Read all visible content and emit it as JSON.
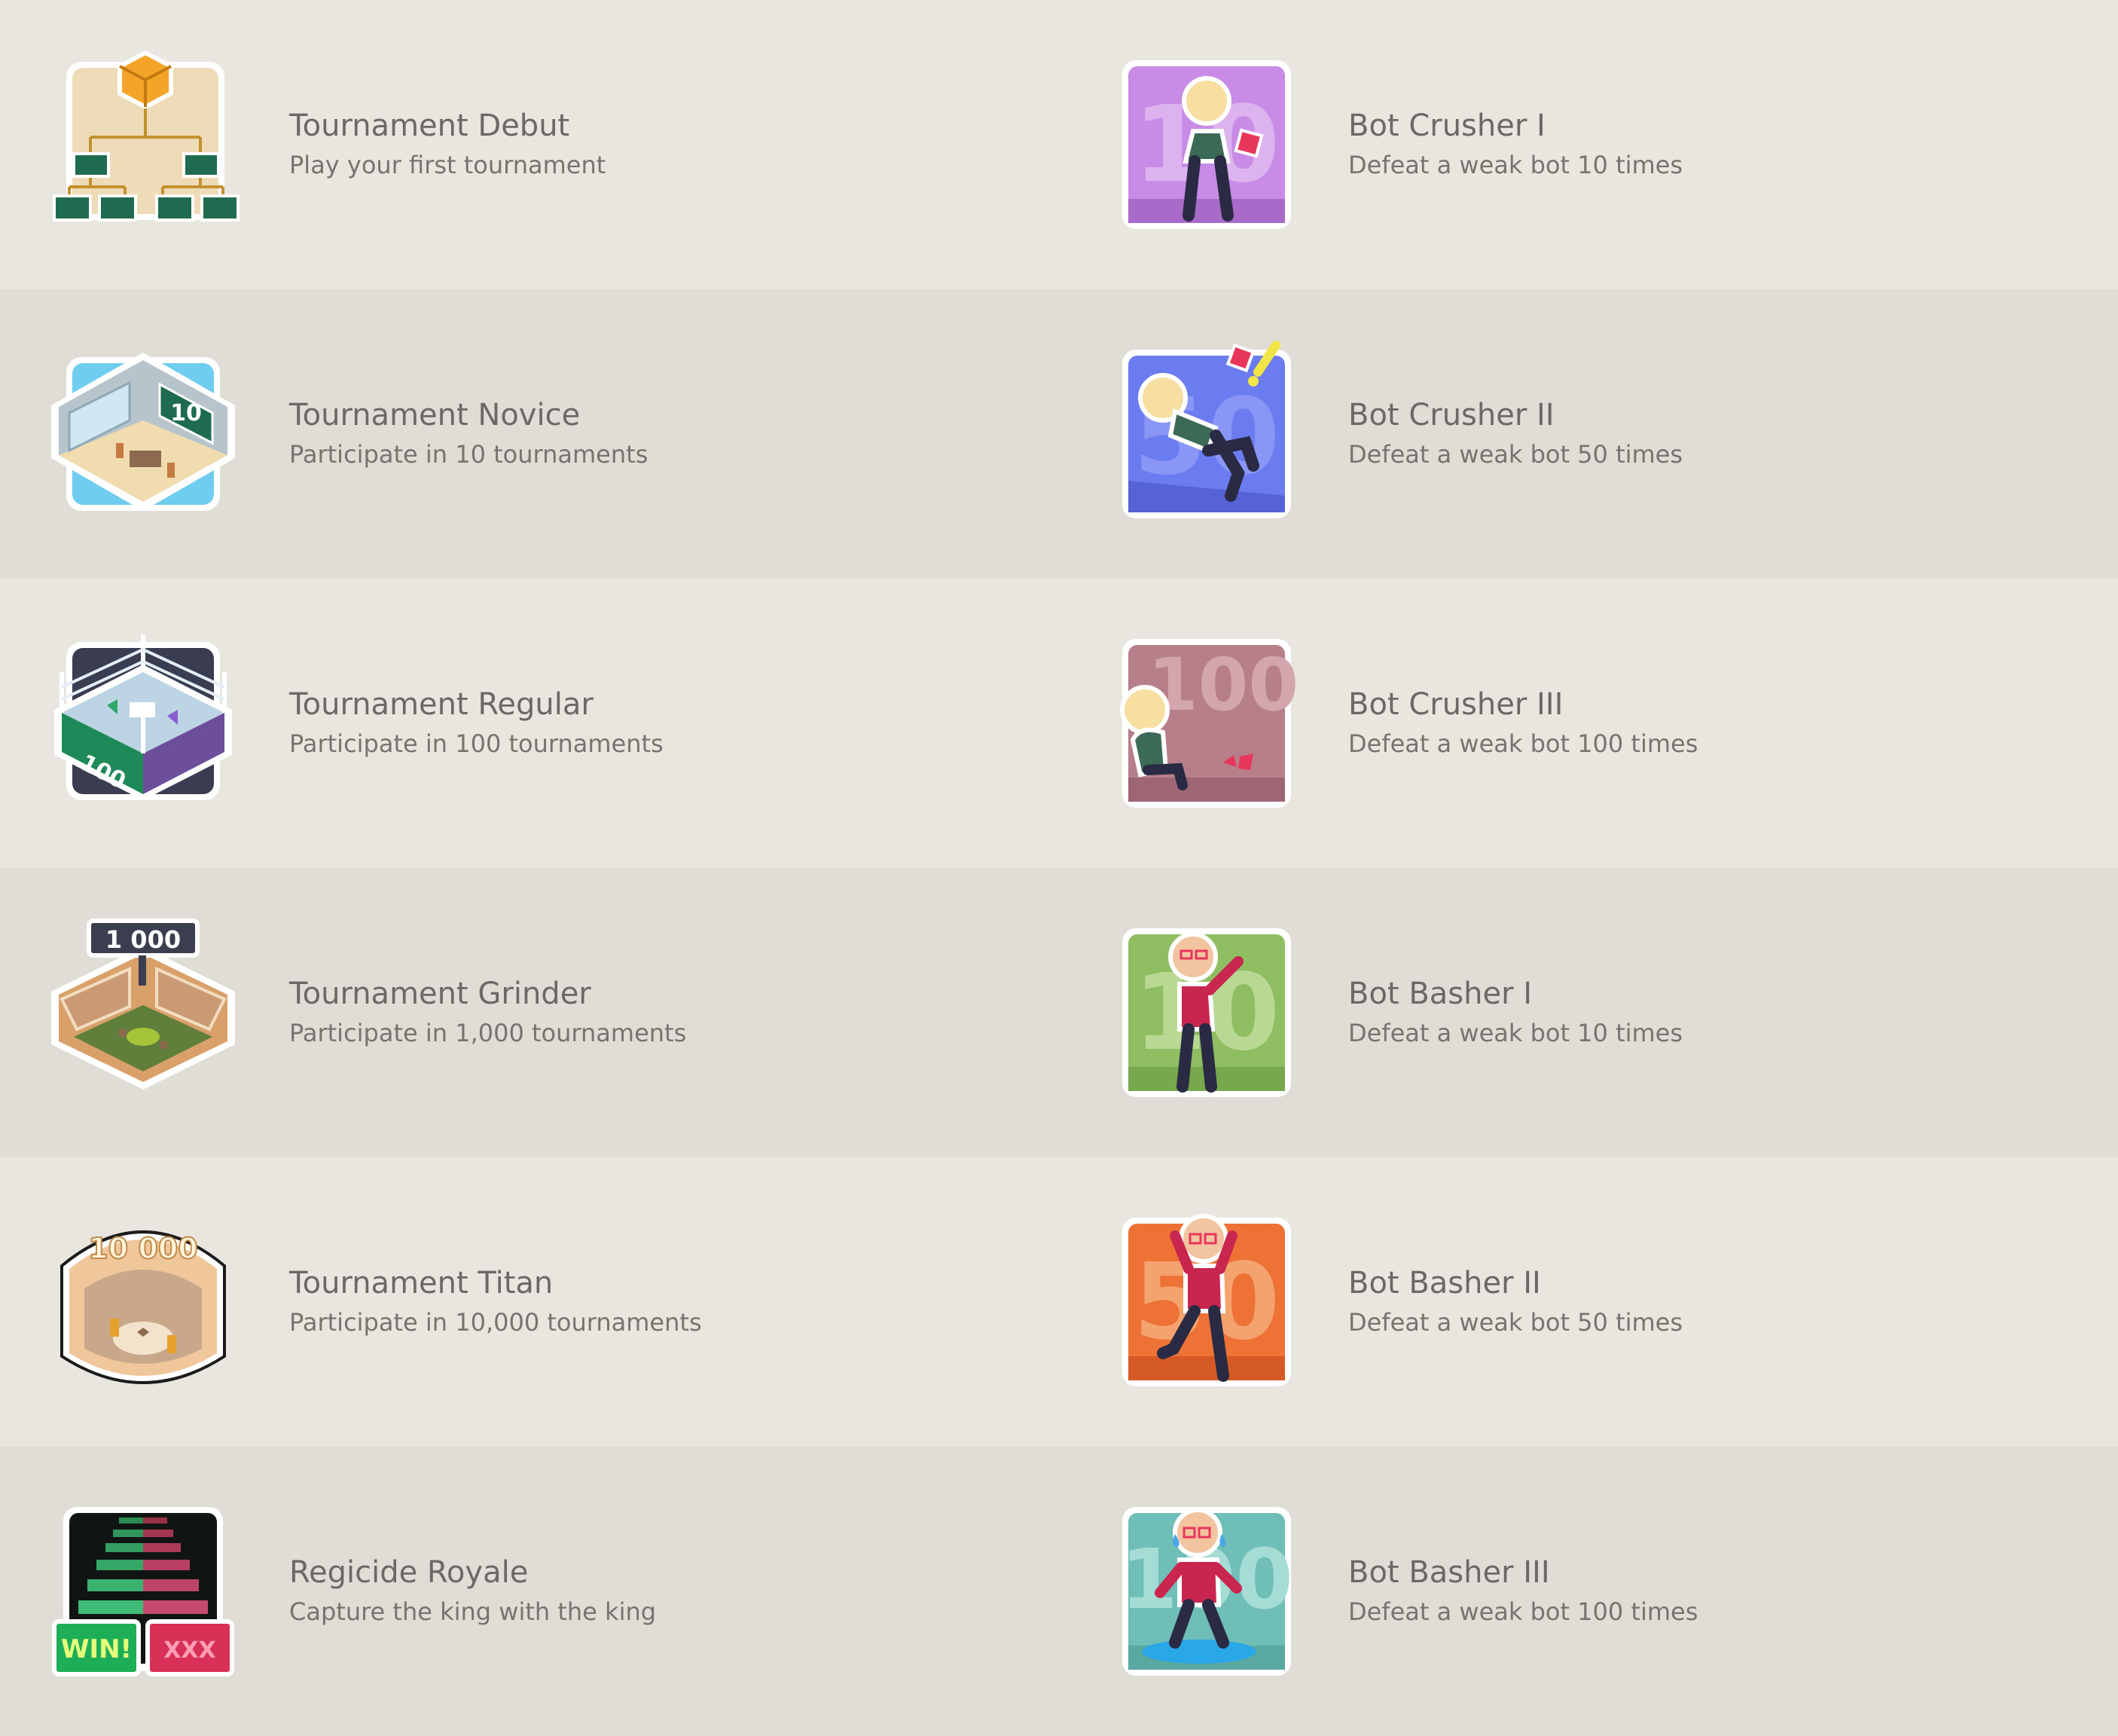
{
  "achievements": [
    {
      "title": "Tournament Debut",
      "description": "Play your first tournament",
      "icon": "tournament-bracket-icon"
    },
    {
      "title": "Bot Crusher I",
      "description": "Defeat a weak bot 10 times",
      "icon": "bot-crusher-10-icon"
    },
    {
      "title": "Tournament Novice",
      "description": "Participate in 10 tournaments",
      "icon": "classroom-10-icon"
    },
    {
      "title": "Bot Crusher II",
      "description": "Defeat a weak bot 50 times",
      "icon": "bot-crusher-50-icon"
    },
    {
      "title": "Tournament Regular",
      "description": "Participate in 100 tournaments",
      "icon": "boxing-ring-100-icon"
    },
    {
      "title": "Bot Crusher III",
      "description": "Defeat a weak bot 100 times",
      "icon": "bot-crusher-100-icon"
    },
    {
      "title": "Tournament Grinder",
      "description": "Participate in 1,000 tournaments",
      "icon": "stadium-1000-icon"
    },
    {
      "title": "Bot Basher I",
      "description": "Defeat a weak bot 10 times",
      "icon": "bot-basher-10-icon"
    },
    {
      "title": "Tournament Titan",
      "description": "Participate in 10,000 tournaments",
      "icon": "arena-10000-icon"
    },
    {
      "title": "Bot Basher II",
      "description": "Defeat a weak bot 50 times",
      "icon": "bot-basher-50-icon"
    },
    {
      "title": "Regicide Royale",
      "description": "Capture the king with the king",
      "icon": "win-xxx-stack-icon"
    },
    {
      "title": "Bot Basher III",
      "description": "Defeat a weak bot 100 times",
      "icon": "bot-basher-100-icon"
    }
  ],
  "badge_text": {
    "novice": "10",
    "regular": "100",
    "grinder": "1 000",
    "titan": "10 000",
    "crusher1": "10",
    "crusher2": "50",
    "crusher3": "100",
    "basher1": "10",
    "basher2": "50",
    "basher3": "100",
    "win": "WIN!",
    "xxx": "XXX"
  },
  "colors": {
    "background_odd": "#e9e6e0",
    "background_even": "#e0ddd7",
    "title": "#6b6966",
    "description": "#77746f"
  }
}
